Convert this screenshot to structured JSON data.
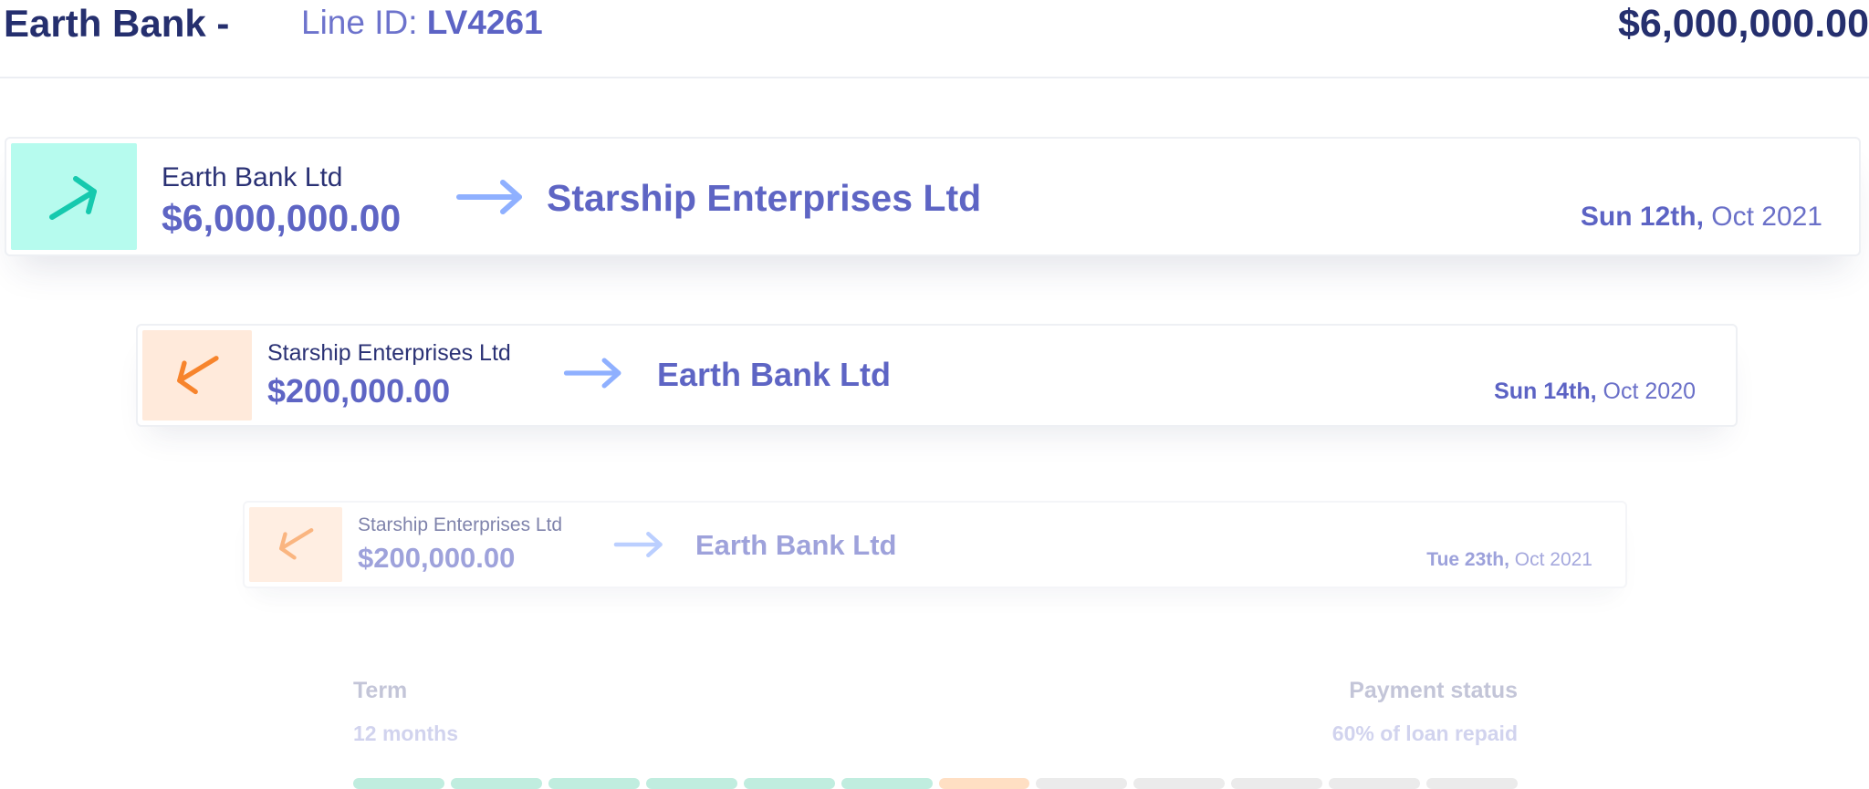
{
  "header": {
    "bank_name": "Earth Bank -",
    "line_id_label": "Line ID:",
    "line_id_value": "LV4261",
    "total": "$6,000,000.00"
  },
  "transactions": [
    {
      "direction": "outgoing",
      "icon": "arrow-up-right-icon",
      "from": "Earth Bank Ltd",
      "amount": "$6,000,000.00",
      "to": "Starship Enterprises Ltd",
      "date_day": "Sun 12th,",
      "date_rest": "Oct 2021",
      "icon_color": "#16c9ae",
      "icon_bg": "#b6fbee"
    },
    {
      "direction": "incoming",
      "icon": "arrow-down-left-icon",
      "from": "Starship Enterprises Ltd",
      "amount": "$200,000.00",
      "to": "Earth Bank Ltd",
      "date_day": "Sun 14th,",
      "date_rest": "Oct 2020",
      "icon_color": "#f7842c",
      "icon_bg": "#ffeadb"
    },
    {
      "direction": "incoming",
      "icon": "arrow-down-left-icon",
      "from": "Starship Enterprises Ltd",
      "amount": "$200,000.00",
      "to": "Earth Bank Ltd",
      "date_day": "Tue 23th,",
      "date_rest": "Oct 2021",
      "icon_color": "#f7842c",
      "icon_bg": "#ffe3cf"
    }
  ],
  "terms": {
    "term_label": "Term",
    "term_value": "12 months",
    "status_label": "Payment status",
    "status_value": "60% of loan repaid",
    "segments": [
      "paid",
      "paid",
      "paid",
      "paid",
      "paid",
      "paid",
      "current",
      "pending",
      "pending",
      "pending",
      "pending",
      "pending"
    ]
  },
  "colors": {
    "paid": "#1fc08e",
    "current": "#ff8f2c",
    "pending": "#b8b8b8",
    "accent": "#5e65c4",
    "navy": "#252f6e",
    "arrow": "#8fb0ff"
  }
}
